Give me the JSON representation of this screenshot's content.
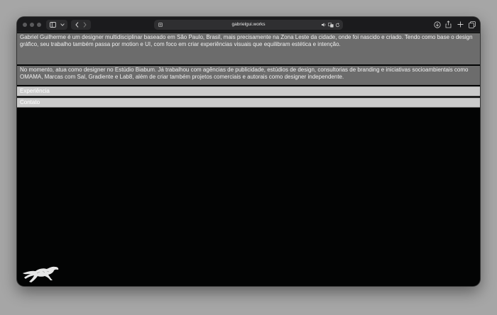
{
  "browser": {
    "url": "gabrielgui.works"
  },
  "page": {
    "bio_paragraph_1": "Gabriel Guilherme é um designer multidisciplinar baseado em São Paulo, Brasil, mais precisamente na Zona Leste da cidade, onde foi nascido e criado. Tendo como base o design gráfico, seu trabalho também passa por motion e UI, com foco em criar experiências visuais que equilibram estética e intenção.",
    "bio_paragraph_2": "No momento, atua como designer no Estúdio Biabum. Já trabalhou com agências de publicidade, estúdios de design, consultorias de branding e iniciativas socioambientais como OMAMA, Marcas com Sal, Gradiente e Lab8, além de criar também projetos comerciais e autorais como designer independente.",
    "sections": [
      {
        "label": "Experiência"
      },
      {
        "label": "Contato"
      }
    ]
  },
  "colors": {
    "page_background": "#030404",
    "bio_block": "#6c6c6c",
    "section_bar": "#cbcbcb"
  },
  "icons": [
    "sidebar-toggle-icon",
    "chevron-down-icon",
    "back-icon",
    "forward-icon",
    "reader-icon",
    "speaker-icon",
    "translate-icon",
    "reload-icon",
    "download-icon",
    "share-icon",
    "new-tab-icon",
    "tabs-overview-icon",
    "horse-logo-icon"
  ]
}
